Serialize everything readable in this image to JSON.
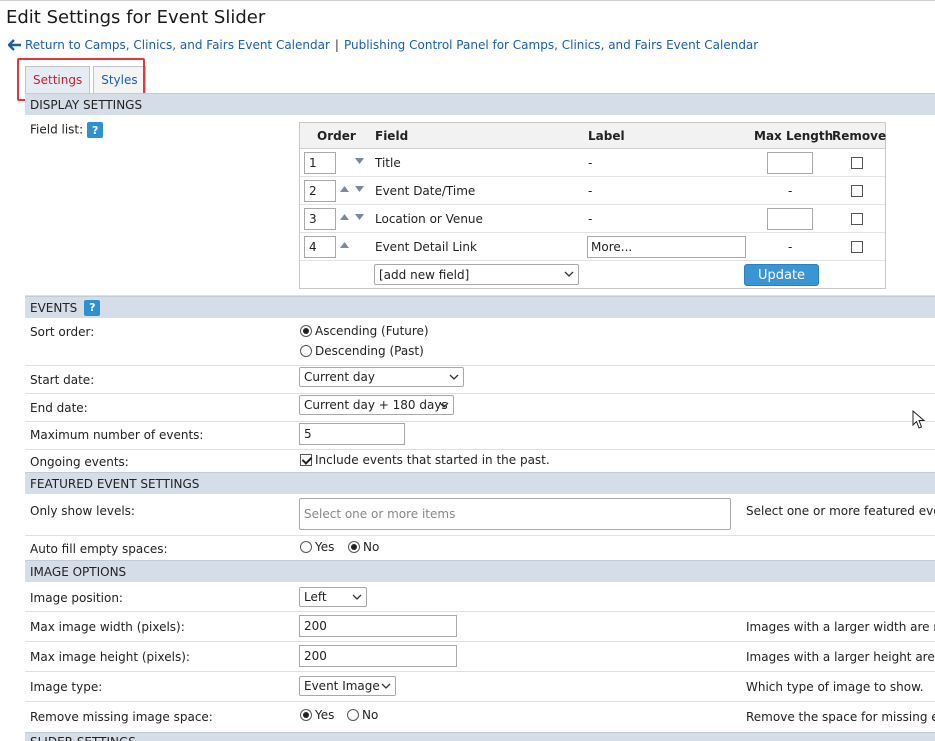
{
  "page": {
    "title": "Edit Settings for Event Slider"
  },
  "breadcrumb": {
    "link1": "Return to Camps, Clinics, and Fairs Event Calendar",
    "separator": "|",
    "link2": "Publishing Control Panel for Camps, Clinics, and Fairs Event Calendar"
  },
  "tabs": [
    {
      "label": "Settings",
      "active": true
    },
    {
      "label": "Styles",
      "active": false
    }
  ],
  "display_settings": {
    "header": "DISPLAY SETTINGS",
    "field_list_label": "Field list:",
    "help": "?",
    "columns": {
      "order": "Order",
      "field": "Field",
      "label": "Label",
      "max_length": "Max Length",
      "remove": "Remove"
    },
    "rows": [
      {
        "order": "1",
        "field": "Title",
        "label": "-",
        "max_length": ""
      },
      {
        "order": "2",
        "field": "Event Date/Time",
        "label": "-",
        "max_length": "-"
      },
      {
        "order": "3",
        "field": "Location or Venue",
        "label": "-",
        "max_length": ""
      },
      {
        "order": "4",
        "field": "Event Detail Link",
        "label": "More...",
        "max_length": "-"
      }
    ],
    "add_field": "[add new field]",
    "update": "Update"
  },
  "events": {
    "header": "EVENTS",
    "help": "?",
    "sort_order_label": "Sort order:",
    "sort_ascending": "Ascending (Future)",
    "sort_descending": "Descending (Past)",
    "start_date_label": "Start date:",
    "start_date": "Current day",
    "end_date_label": "End date:",
    "end_date": "Current day + 180 days",
    "max_events_label": "Maximum number of events:",
    "max_events": "5",
    "ongoing_label": "Ongoing events:",
    "ongoing_option": "Include events that started in the past."
  },
  "featured": {
    "header": "FEATURED EVENT SETTINGS",
    "levels_label": "Only show levels:",
    "levels_placeholder": "Select one or more items",
    "levels_desc": "Select one or more featured event",
    "autofill_label": "Auto fill empty spaces:",
    "yes": "Yes",
    "no": "No"
  },
  "image_options": {
    "header": "IMAGE OPTIONS",
    "position_label": "Image position:",
    "position": "Left",
    "width_label": "Max image width (pixels):",
    "width": "200",
    "width_desc": "Images with a larger width are re",
    "height_label": "Max image height (pixels):",
    "height": "200",
    "height_desc": "Images with a larger height are re",
    "type_label": "Image type:",
    "type": "Event Image",
    "type_desc": "Which type of image to show.",
    "remove_label": "Remove missing image space:",
    "yes": "Yes",
    "no": "No",
    "remove_desc": "Remove the space for missing eve"
  },
  "slider": {
    "header": "SLIDER SETTINGS"
  }
}
